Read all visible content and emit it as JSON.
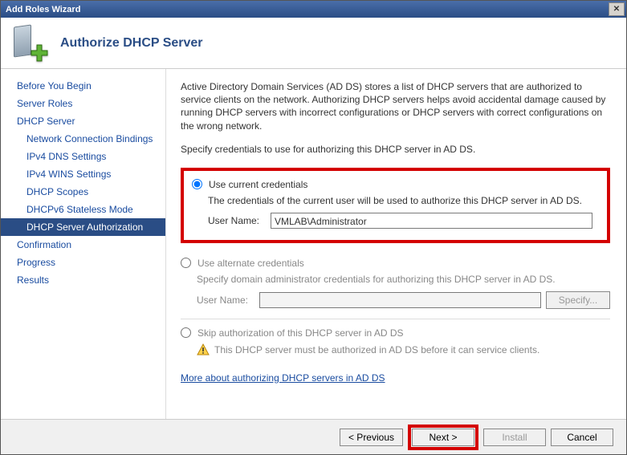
{
  "window": {
    "title": "Add Roles Wizard"
  },
  "header": {
    "title": "Authorize DHCP Server"
  },
  "sidebar": {
    "items": [
      {
        "label": "Before You Begin",
        "sub": false
      },
      {
        "label": "Server Roles",
        "sub": false
      },
      {
        "label": "DHCP Server",
        "sub": false
      },
      {
        "label": "Network Connection Bindings",
        "sub": true
      },
      {
        "label": "IPv4 DNS Settings",
        "sub": true
      },
      {
        "label": "IPv4 WINS Settings",
        "sub": true
      },
      {
        "label": "DHCP Scopes",
        "sub": true
      },
      {
        "label": "DHCPv6 Stateless Mode",
        "sub": true
      },
      {
        "label": "DHCP Server Authorization",
        "sub": true
      },
      {
        "label": "Confirmation",
        "sub": false
      },
      {
        "label": "Progress",
        "sub": false
      },
      {
        "label": "Results",
        "sub": false
      }
    ],
    "selected_index": 8
  },
  "main": {
    "intro": "Active Directory Domain Services (AD DS) stores a list of DHCP servers that are authorized to service clients on the network. Authorizing DHCP servers helps avoid accidental damage caused by running DHCP servers with incorrect configurations or DHCP servers with correct configurations on the wrong network.",
    "instruction": "Specify credentials to use for authorizing this DHCP server in AD DS.",
    "opt1": {
      "label": "Use current credentials",
      "desc": "The credentials of the current user will be used to authorize this DHCP server in AD DS.",
      "user_label": "User Name:",
      "user_value": "VMLAB\\Administrator"
    },
    "opt2": {
      "label": "Use alternate credentials",
      "desc": "Specify domain administrator credentials for authorizing this DHCP server in AD DS.",
      "user_label": "User Name:",
      "user_value": "",
      "specify_btn": "Specify..."
    },
    "opt3": {
      "label": "Skip authorization of this DHCP server in AD DS",
      "warn": "This DHCP server must be authorized in AD DS before it can service clients."
    },
    "link": "More about authorizing DHCP servers in AD DS"
  },
  "footer": {
    "previous": "< Previous",
    "next": "Next >",
    "install": "Install",
    "cancel": "Cancel"
  }
}
